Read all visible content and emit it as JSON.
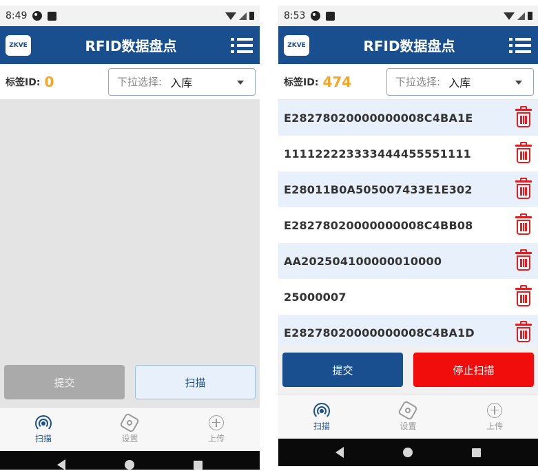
{
  "screens": [
    {
      "status_time": "8:49",
      "app_title": "RFID数据盘点",
      "logo_text": "ZKVE",
      "tag_label": "标签ID:",
      "tag_count": "0",
      "dropdown_prefix": "下拉选择:",
      "dropdown_value": "入库",
      "submit_label": "提交",
      "scan_label": "扫描",
      "nav": [
        "扫描",
        "设置",
        "上传"
      ]
    },
    {
      "status_time": "8:53",
      "app_title": "RFID数据盘点",
      "logo_text": "ZKVE",
      "tag_label": "标签ID:",
      "tag_count": "474",
      "dropdown_prefix": "下拉选择:",
      "dropdown_value": "入库",
      "submit_label": "提交",
      "scan_label": "停止扫描",
      "nav": [
        "扫描",
        "设置",
        "上传"
      ],
      "tags": [
        "E28278020000000008C4BA1E",
        "111122223333444455551111",
        "E28011B0A505007433E1E302",
        "E28278020000000008C4BB08",
        "AA202504100000010000",
        "25000007",
        "E28278020000000008C4BA1D"
      ]
    }
  ],
  "colors": {
    "primary": "#1a4f8f",
    "accent_count": "#f5a623",
    "danger": "#f20d0d",
    "row_alt": "#e8f1fb"
  }
}
